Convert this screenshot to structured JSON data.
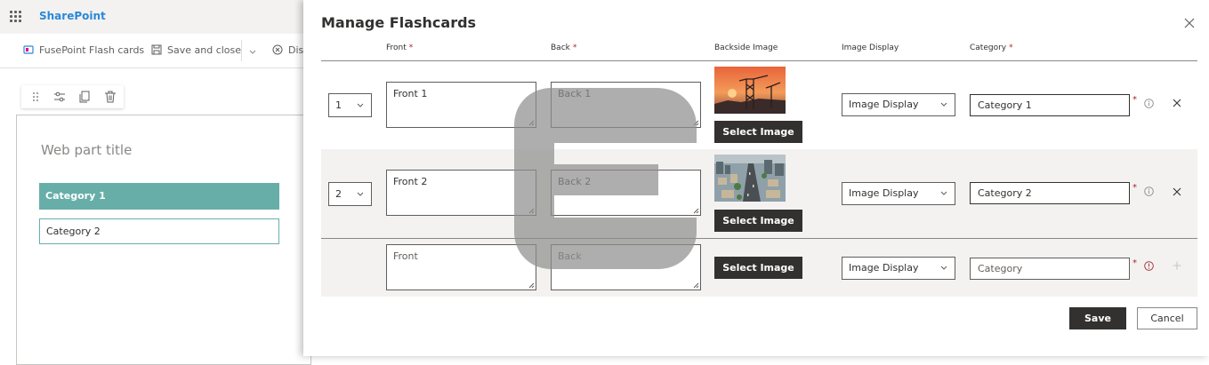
{
  "sharepoint": {
    "brand": "SharePoint",
    "cmdbar": {
      "flashcards_label": "FusePoint Flash cards",
      "save_close_label": "Save and close",
      "discard_label": "Dis"
    },
    "webpart": {
      "title_placeholder": "Web part title",
      "categories": [
        "Category 1",
        "Category 2"
      ]
    }
  },
  "panel": {
    "title": "Manage Flashcards",
    "columns": {
      "front": "Front",
      "back": "Back",
      "backside_image": "Backside Image",
      "image_display": "Image Display",
      "category": "Category",
      "required_mark": "*"
    },
    "rows": [
      {
        "order": "1",
        "front": "Front 1",
        "back": "Back 1",
        "image_display": "Image Display",
        "category": "Category 1",
        "select_image": "Select Image"
      },
      {
        "order": "2",
        "front": "Front 2",
        "back": "Back 2",
        "image_display": "Image Display",
        "category": "Category 2",
        "select_image": "Select Image"
      }
    ],
    "new_row": {
      "front_placeholder": "Front",
      "back_placeholder": "Back",
      "image_display": "Image Display",
      "category_placeholder": "Category",
      "select_image": "Select Image"
    },
    "save_label": "Save",
    "cancel_label": "Cancel"
  },
  "colors": {
    "accent_teal": "#67aea9",
    "dark_button": "#323130",
    "required": "#a4262c",
    "brand_blue": "#2b88d8"
  }
}
